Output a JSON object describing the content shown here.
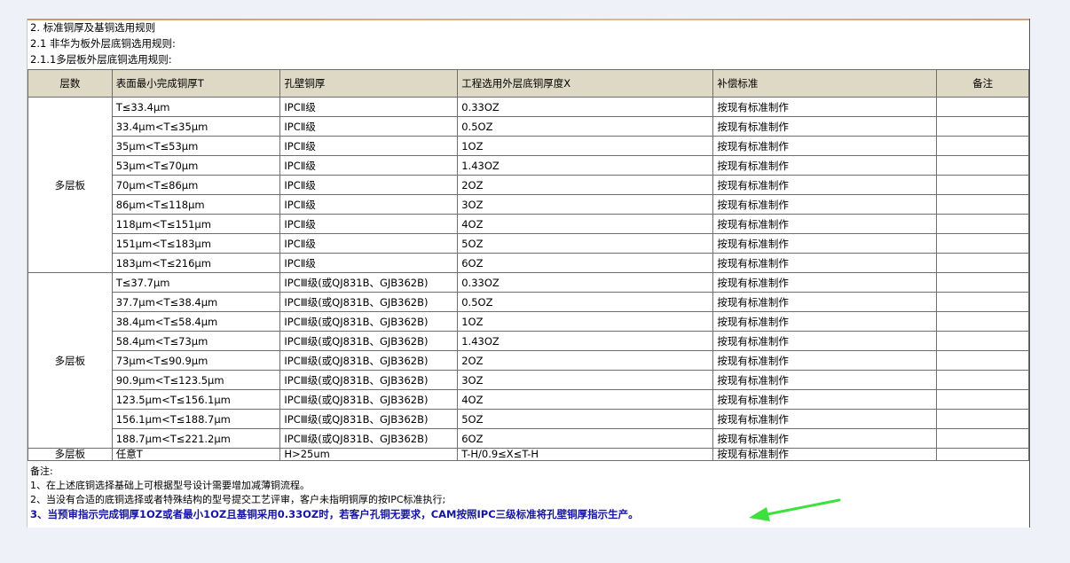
{
  "titles": {
    "line1": "2. 标准铜厚及基铜选用规则",
    "line2": "2.1 非华为板外层底铜选用规则:",
    "line3": "2.1.1多层板外层底铜选用规则:"
  },
  "table": {
    "headers": [
      "层数",
      "表面最小完成铜厚T",
      "孔壁铜厚",
      "工程选用外层底铜厚度X",
      "补偿标准",
      "备注"
    ],
    "group1": {
      "layer": "多层板",
      "rows": [
        [
          "T≤33.4μm",
          "IPCⅡ级",
          "0.33OZ",
          "按现有标准制作",
          ""
        ],
        [
          "33.4μm<T≤35μm",
          "IPCⅡ级",
          "0.5OZ",
          "按现有标准制作",
          ""
        ],
        [
          "35μm<T≤53μm",
          "IPCⅡ级",
          "1OZ",
          "按现有标准制作",
          ""
        ],
        [
          "53μm<T≤70μm",
          "IPCⅡ级",
          "1.43OZ",
          "按现有标准制作",
          ""
        ],
        [
          "70μm<T≤86μm",
          "IPCⅡ级",
          "2OZ",
          "按现有标准制作",
          ""
        ],
        [
          "86μm<T≤118μm",
          "IPCⅡ级",
          "3OZ",
          "按现有标准制作",
          ""
        ],
        [
          "118μm<T≤151μm",
          "IPCⅡ级",
          "4OZ",
          "按现有标准制作",
          ""
        ],
        [
          "151μm<T≤183μm",
          "IPCⅡ级",
          "5OZ",
          "按现有标准制作",
          ""
        ],
        [
          "183μm<T≤216μm",
          "IPCⅡ级",
          "6OZ",
          "按现有标准制作",
          ""
        ]
      ]
    },
    "group2": {
      "layer": "多层板",
      "rows": [
        [
          "T≤37.7μm",
          "IPCⅢ级(或QJ831B、GJB362B)",
          "0.33OZ",
          "按现有标准制作",
          ""
        ],
        [
          "37.7μm<T≤38.4μm",
          "IPCⅢ级(或QJ831B、GJB362B)",
          "0.5OZ",
          "按现有标准制作",
          ""
        ],
        [
          "38.4μm<T≤58.4μm",
          "IPCⅢ级(或QJ831B、GJB362B)",
          "1OZ",
          "按现有标准制作",
          ""
        ],
        [
          "58.4μm<T≤73μm",
          "IPCⅢ级(或QJ831B、GJB362B)",
          "1.43OZ",
          "按现有标准制作",
          ""
        ],
        [
          "73μm<T≤90.9μm",
          "IPCⅢ级(或QJ831B、GJB362B)",
          "2OZ",
          "按现有标准制作",
          ""
        ],
        [
          "90.9μm<T≤123.5μm",
          "IPCⅢ级(或QJ831B、GJB362B)",
          "3OZ",
          "按现有标准制作",
          ""
        ],
        [
          "123.5μm<T≤156.1μm",
          "IPCⅢ级(或QJ831B、GJB362B)",
          "4OZ",
          "按现有标准制作",
          ""
        ],
        [
          "156.1μm<T≤188.7μm",
          "IPCⅢ级(或QJ831B、GJB362B)",
          "5OZ",
          "按现有标准制作",
          ""
        ],
        [
          "188.7μm<T≤221.2μm",
          "IPCⅢ级(或QJ831B、GJB362B)",
          "6OZ",
          "按现有标准制作",
          ""
        ]
      ]
    },
    "last_row": [
      "多层板",
      "任意T",
      "H>25um",
      "T-H/0.9≤X≤T-H",
      "按现有标准制作",
      ""
    ]
  },
  "notes": {
    "label": "备注:",
    "items": [
      "1、在上述底铜选择基础上可根据型号设计需要增加减薄铜流程。",
      "2、当没有合适的底铜选择或者特殊结构的型号提交工艺评审，客户未指明铜厚的按IPC标准执行;",
      "3、当预审指示完成铜厚1OZ或者最小1OZ且基铜采用0.33OZ时，若客户孔铜无要求，CAM按照IPC三级标准将孔壁铜厚指示生产。"
    ]
  },
  "colors": {
    "header_bg": "#ded9c4",
    "highlight_note": "#1515a0",
    "arrow": "#3ee03e",
    "background": "#eef1f7"
  }
}
